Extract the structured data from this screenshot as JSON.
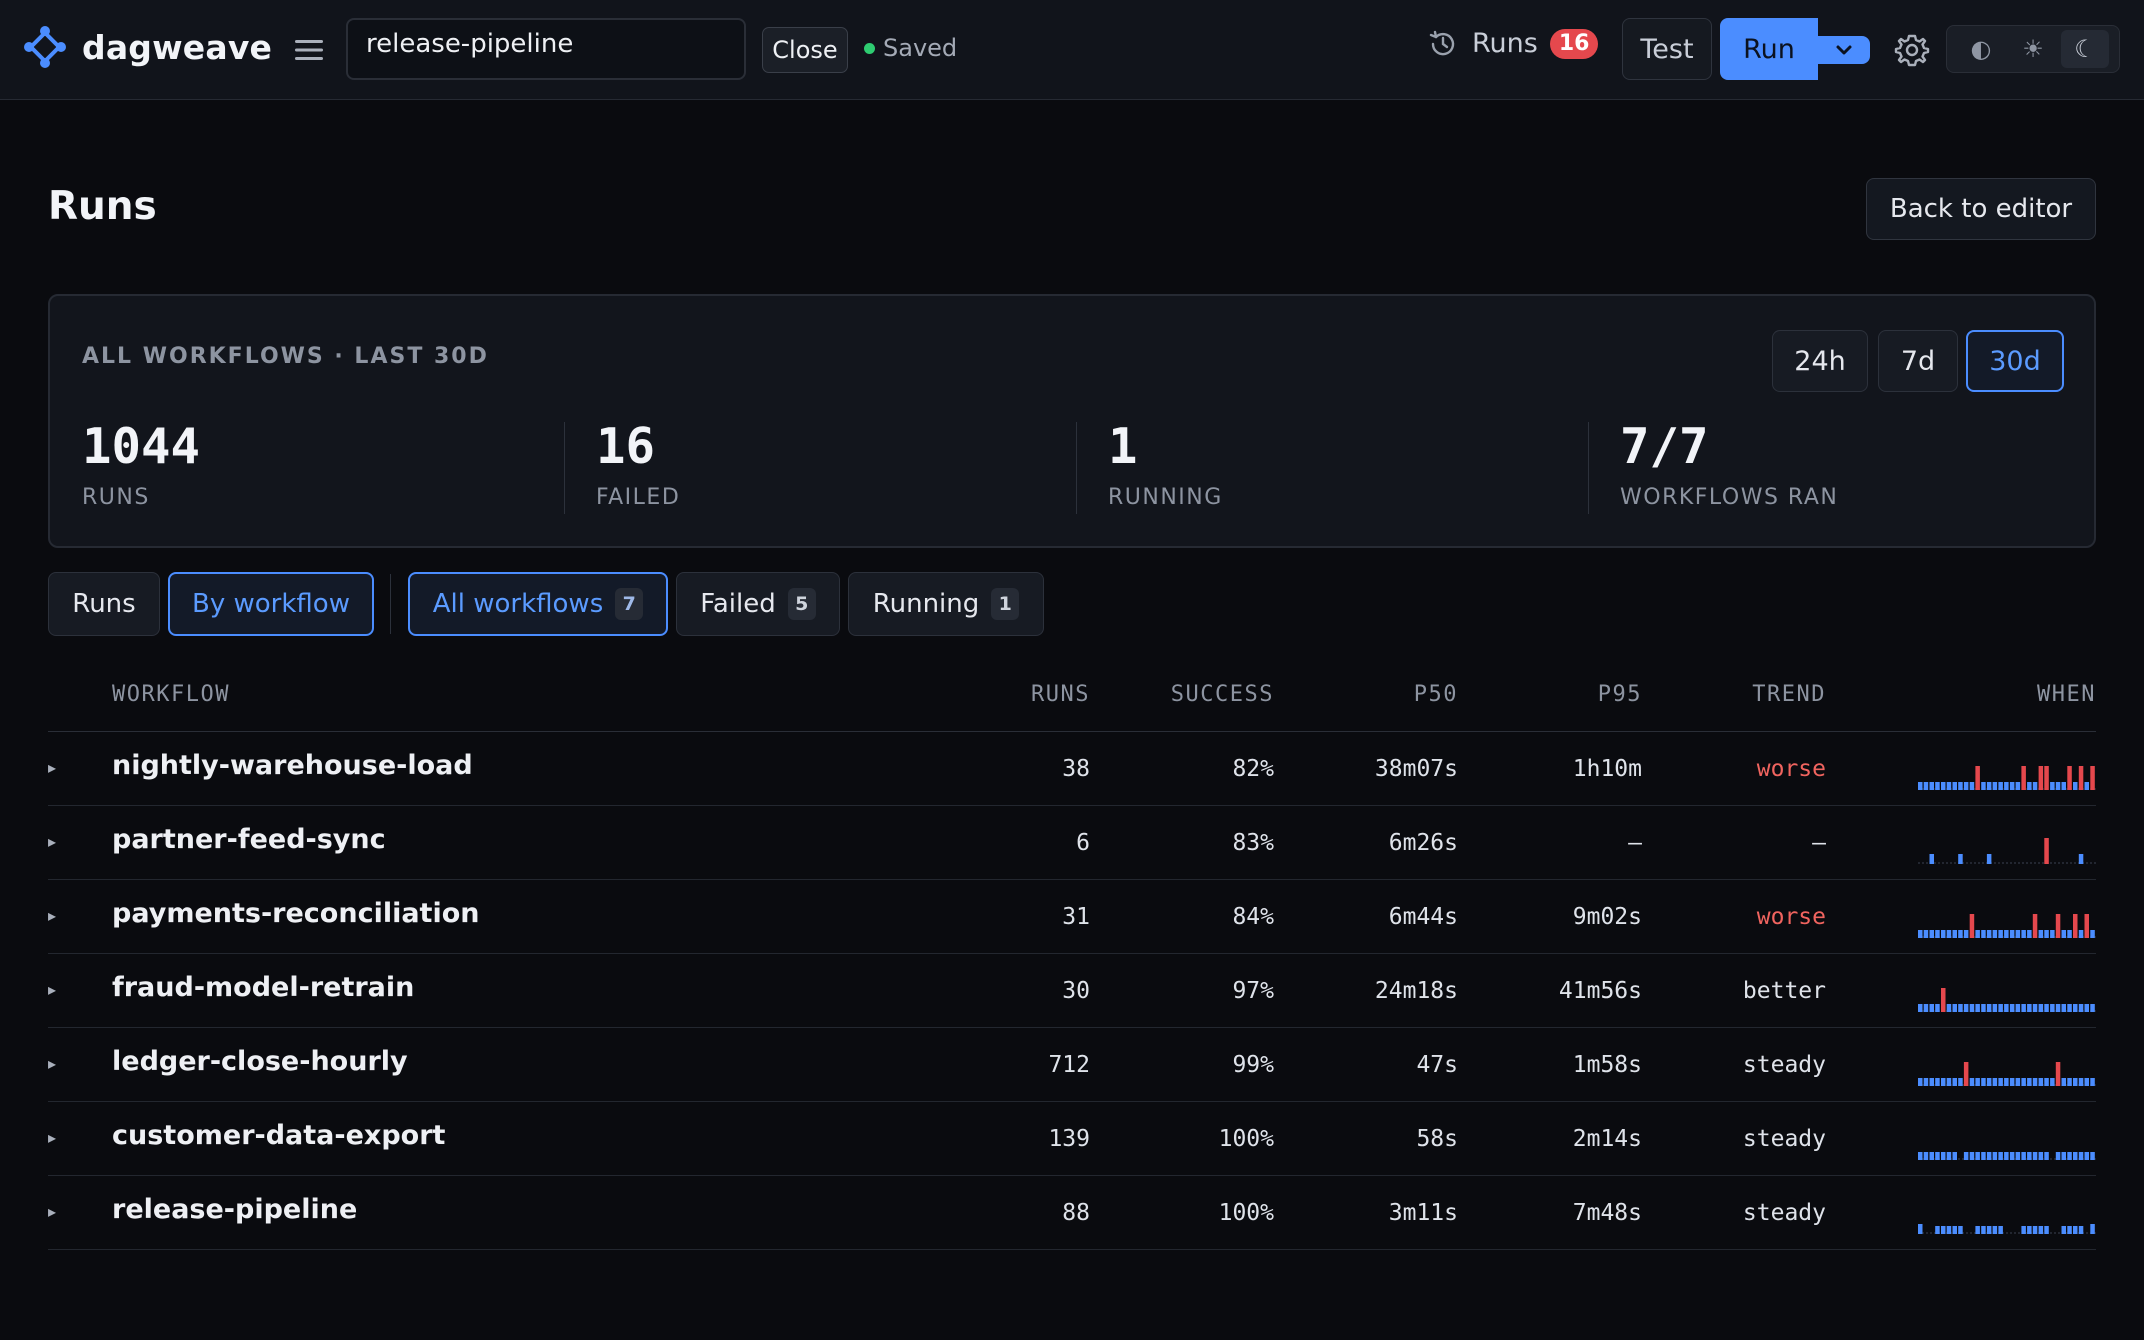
{
  "app": {
    "name": "dagweave"
  },
  "topbar": {
    "workflow_name": "release-pipeline",
    "close_label": "Close",
    "saved_label": "Saved",
    "runs_label": "Runs",
    "runs_badge": "16",
    "test_label": "Test",
    "run_label": "Run",
    "theme_options": [
      {
        "icon": "contrast-icon",
        "glyph": "◐"
      },
      {
        "icon": "sun-icon",
        "glyph": "☀"
      },
      {
        "icon": "moon-icon",
        "glyph": "☾"
      }
    ]
  },
  "page": {
    "title": "Runs",
    "back_label": "Back to editor"
  },
  "summary": {
    "title": "ALL WORKFLOWS · LAST 30D",
    "ranges": [
      "24h",
      "7d",
      "30d"
    ],
    "active_range": "30d",
    "stats": [
      {
        "value": "1044",
        "label": "RUNS"
      },
      {
        "value": "16",
        "label": "FAILED"
      },
      {
        "value": "1",
        "label": "RUNNING"
      },
      {
        "value": "7/7",
        "label": "WORKFLOWS RAN"
      }
    ]
  },
  "view_toggle": {
    "runs": "Runs",
    "by_workflow": "By workflow",
    "active": "by_workflow"
  },
  "filters": [
    {
      "label": "All workflows",
      "count": "7",
      "active": true
    },
    {
      "label": "Failed",
      "count": "5",
      "active": false
    },
    {
      "label": "Running",
      "count": "1",
      "active": false
    }
  ],
  "table": {
    "columns": [
      "WORKFLOW",
      "RUNS",
      "SUCCESS",
      "P50",
      "P95",
      "TREND",
      "WHEN"
    ],
    "colors": {
      "ok": "#4b8dff",
      "fail": "#e5484d"
    },
    "rows": [
      {
        "workflow": "nightly-warehouse-load",
        "runs": "38",
        "success": "82%",
        "p50": "38m07s",
        "p95": "1h10m",
        "trend": "worse",
        "spark": [
          1,
          1,
          1,
          1,
          1,
          1,
          1,
          1,
          1,
          1,
          3,
          1,
          1,
          1,
          1,
          1,
          1,
          1,
          3,
          1,
          1,
          3,
          3,
          1,
          1,
          1,
          3,
          1,
          3,
          1,
          3
        ]
      },
      {
        "workflow": "partner-feed-sync",
        "runs": "6",
        "success": "83%",
        "p50": "6m26s",
        "p95": "—",
        "trend": "—",
        "spark": [
          0,
          0,
          2,
          0,
          0,
          0,
          0,
          2,
          0,
          0,
          0,
          0,
          2,
          0,
          0,
          0,
          0,
          0,
          0,
          0,
          0,
          0,
          4,
          0,
          0,
          0,
          0,
          0,
          2,
          0,
          0
        ]
      },
      {
        "workflow": "payments-reconciliation",
        "runs": "31",
        "success": "84%",
        "p50": "6m44s",
        "p95": "9m02s",
        "trend": "worse",
        "spark": [
          1,
          1,
          1,
          1,
          1,
          1,
          1,
          1,
          1,
          3,
          1,
          1,
          1,
          1,
          1,
          1,
          1,
          1,
          1,
          1,
          3,
          1,
          1,
          1,
          3,
          1,
          1,
          3,
          1,
          3,
          1
        ]
      },
      {
        "workflow": "fraud-model-retrain",
        "runs": "30",
        "success": "97%",
        "p50": "24m18s",
        "p95": "41m56s",
        "trend": "better",
        "spark": [
          1,
          1,
          1,
          1,
          3,
          1,
          1,
          1,
          1,
          1,
          1,
          1,
          1,
          1,
          1,
          1,
          1,
          1,
          1,
          1,
          1,
          1,
          1,
          1,
          1,
          1,
          1,
          1,
          1,
          1,
          1
        ]
      },
      {
        "workflow": "ledger-close-hourly",
        "runs": "712",
        "success": "99%",
        "p50": "47s",
        "p95": "1m58s",
        "trend": "steady",
        "spark": [
          1,
          1,
          1,
          1,
          1,
          1,
          1,
          1,
          3,
          1,
          1,
          1,
          1,
          1,
          1,
          1,
          1,
          1,
          1,
          1,
          1,
          1,
          1,
          1,
          3,
          1,
          1,
          1,
          1,
          1,
          1
        ]
      },
      {
        "workflow": "customer-data-export",
        "runs": "139",
        "success": "100%",
        "p50": "58s",
        "p95": "2m14s",
        "trend": "steady",
        "spark": [
          1,
          1,
          1,
          1,
          1,
          1,
          1,
          0,
          1,
          1,
          1,
          1,
          1,
          1,
          1,
          1,
          1,
          1,
          1,
          1,
          1,
          1,
          1,
          0,
          1,
          1,
          1,
          1,
          1,
          1,
          1
        ]
      },
      {
        "workflow": "release-pipeline",
        "runs": "88",
        "success": "100%",
        "p50": "3m11s",
        "p95": "7m48s",
        "trend": "steady",
        "spark": [
          2,
          0,
          0,
          1,
          1,
          1,
          1,
          1,
          0,
          0,
          1,
          1,
          1,
          1,
          1,
          0,
          0,
          0,
          1,
          1,
          1,
          1,
          1,
          0,
          0,
          1,
          1,
          1,
          1,
          0,
          2
        ]
      }
    ]
  }
}
